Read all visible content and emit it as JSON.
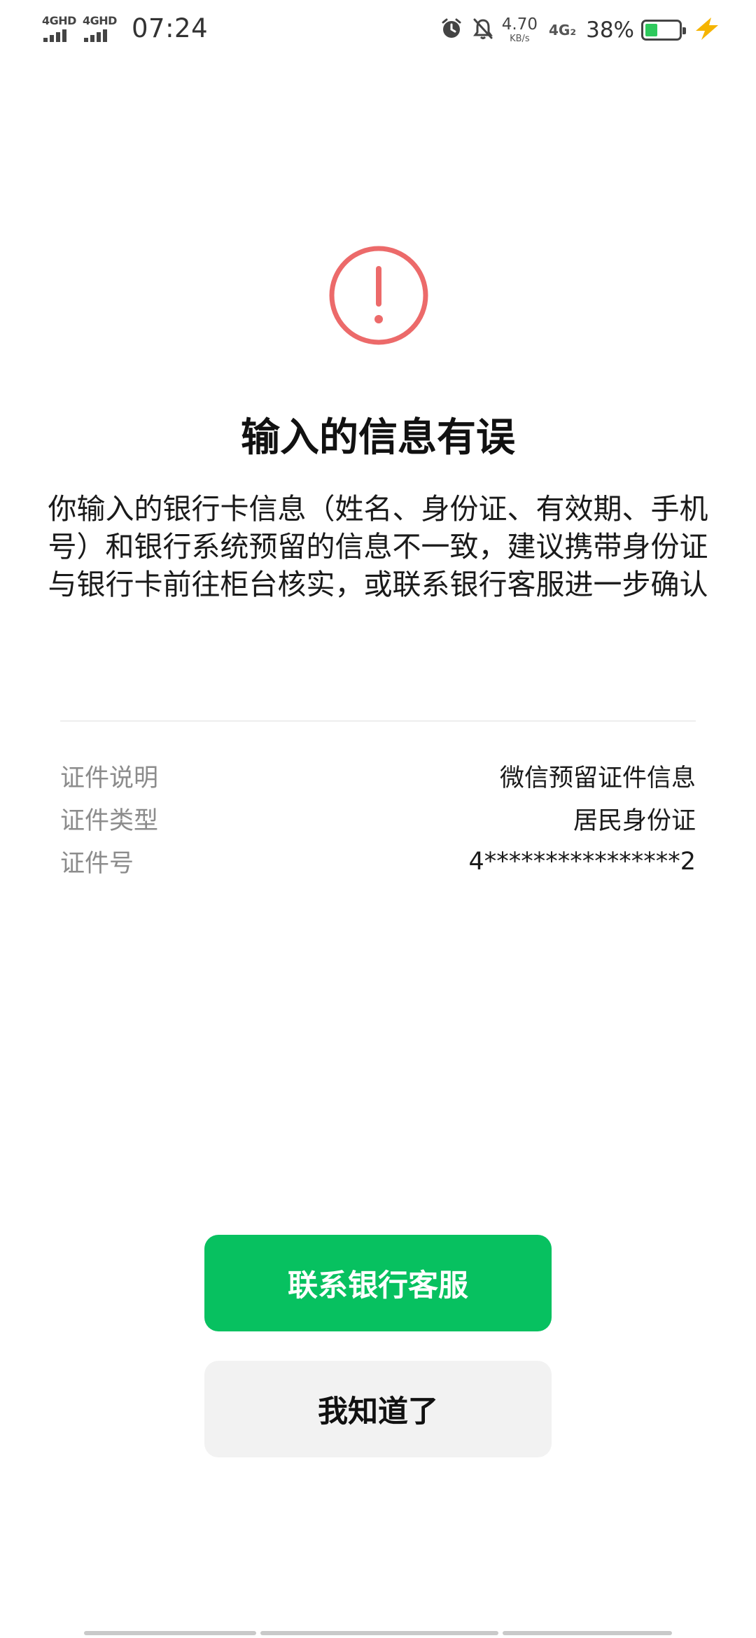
{
  "status_bar": {
    "network1": "4GHD",
    "network2": "4GHD",
    "time": "07:24",
    "speed_value": "4.70",
    "speed_unit": "KB/s",
    "network3": "4G₂",
    "battery_percent": "38%",
    "battery_level": 0.38,
    "battery_color": "#2ec95c",
    "icons": [
      "signal-icon",
      "signal-icon",
      "alarm-icon",
      "bell-off-icon",
      "battery-icon",
      "charging-bolt-icon"
    ]
  },
  "alert": {
    "icon": "exclamation-circle-icon",
    "icon_color": "#ec6a6a",
    "title": "输入的信息有误",
    "description": "你输入的银行卡信息（姓名、身份证、有效期、手机号）和银行系统预留的信息不一致，建议携带身份证与银行卡前往柜台核实，或联系银行客服进一步确认"
  },
  "info": {
    "rows": [
      {
        "label": "证件说明",
        "value": "微信预留证件信息"
      },
      {
        "label": "证件类型",
        "value": "居民身份证"
      },
      {
        "label": "证件号",
        "value": "4****************2"
      }
    ]
  },
  "actions": {
    "primary_label": "联系银行客服",
    "secondary_label": "我知道了",
    "primary_color": "#07c160"
  }
}
